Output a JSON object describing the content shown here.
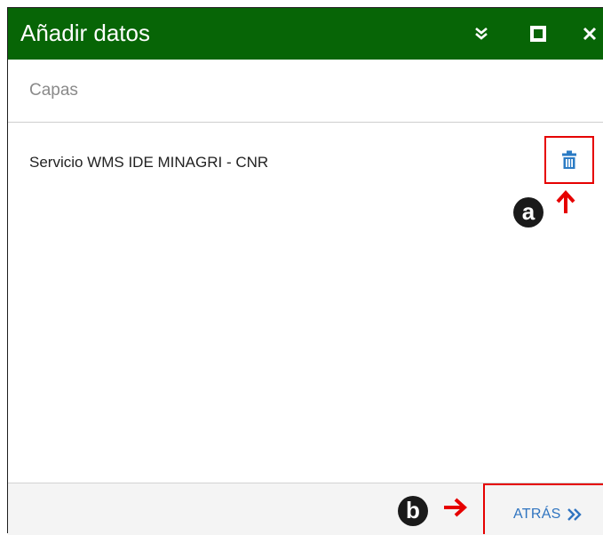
{
  "window": {
    "title": "Añadir datos",
    "title_bg": "#076506",
    "buttons": [
      {
        "name": "collapse",
        "icon": "double-chevron-down-icon"
      },
      {
        "name": "maximize",
        "icon": "square-icon"
      },
      {
        "name": "close",
        "icon": "close-icon"
      }
    ]
  },
  "section": {
    "label": "Capas"
  },
  "layers": [
    {
      "name": "Servicio WMS IDE MINAGRI - CNR",
      "action_icon": "trash-icon"
    }
  ],
  "annotations": {
    "a": "a",
    "b": "b",
    "highlight_color": "#e60000"
  },
  "footer": {
    "back_label": "ATRÁS",
    "back_icon": "double-chevron-right-icon",
    "accent": "#2f74c0"
  }
}
